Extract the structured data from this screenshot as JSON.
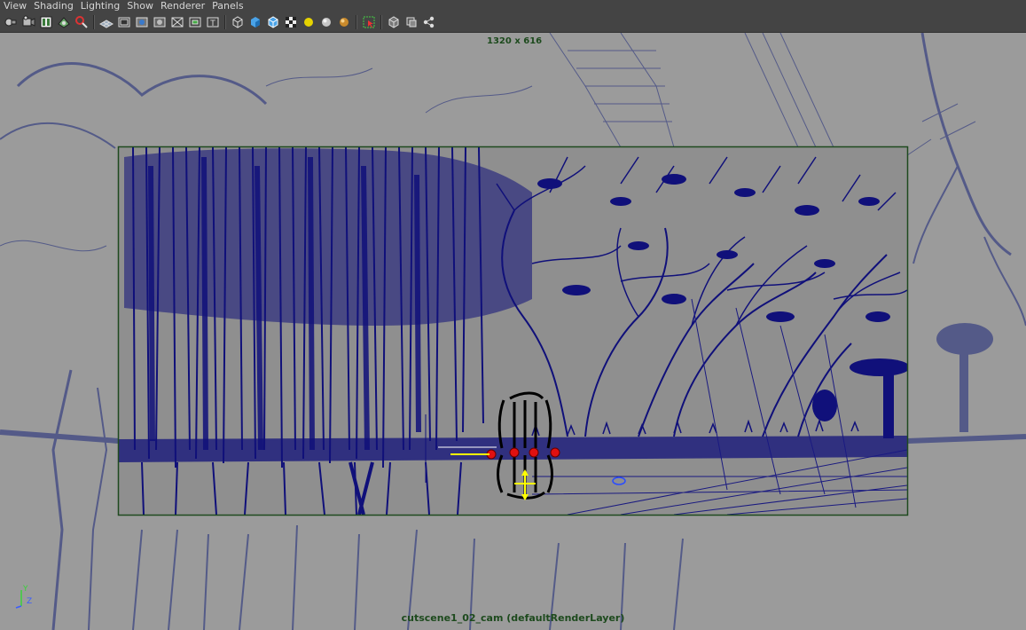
{
  "menubar": {
    "items": [
      {
        "label": "View"
      },
      {
        "label": "Shading"
      },
      {
        "label": "Lighting"
      },
      {
        "label": "Show"
      },
      {
        "label": "Renderer"
      },
      {
        "label": "Panels"
      }
    ]
  },
  "toolbar": {
    "groups": [
      [
        "select-camera-icon",
        "camera-attributes-icon",
        "bookmarks-icon",
        "image-plane-icon",
        "2d-pan-zoom-icon"
      ],
      [
        "grid-icon",
        "film-gate-icon",
        "resolution-gate-icon",
        "gate-mask-icon",
        "field-chart-icon",
        "safe-action-icon",
        "safe-title-icon"
      ],
      [
        "wireframe-icon",
        "smooth-shade-icon",
        "wireframe-on-shaded-icon",
        "textured-icon",
        "use-all-lights-icon",
        "shadows-icon",
        "ambient-occlusion-icon"
      ],
      [
        "isolate-select-icon"
      ],
      [
        "xray-icon",
        "xray-active-icon",
        "xray-joints-icon"
      ]
    ]
  },
  "viewport": {
    "resolution_label": "1320 x 616",
    "camera_label": "cutscene1_02_cam (defaultRenderLayer)",
    "axis": {
      "y": "Y",
      "z": "Z"
    },
    "colors": {
      "background": "#9b9b9b",
      "inner_background": "#8f8f8f",
      "gate_border": "#1f4a1f",
      "wire_inside": "#10107a",
      "wire_outside": "#4d5486",
      "selection_highlight": "#ffff00",
      "active_object": "#000000",
      "keyframe_marker": "#e01010"
    }
  }
}
